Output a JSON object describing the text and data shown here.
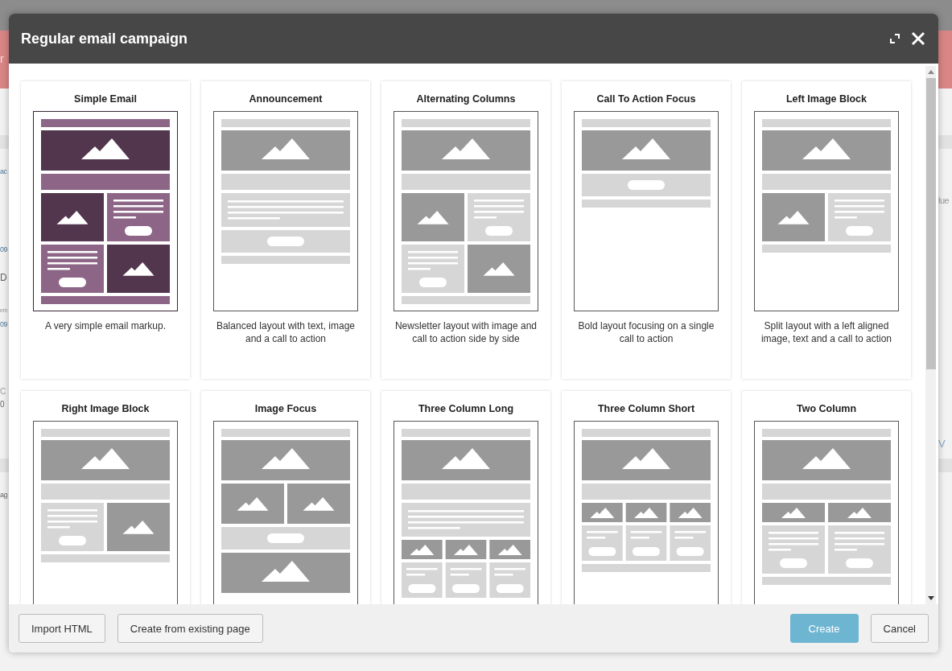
{
  "backdrop": {
    "left_texts": [
      "r",
      "ac",
      "09",
      "D",
      "em",
      "09",
      "C",
      "0",
      "ag"
    ],
    "right_texts": [
      "lue",
      "V"
    ]
  },
  "dialog": {
    "title": "Regular email campaign"
  },
  "templates": [
    {
      "title": "Simple Email",
      "description": "A very simple email markup."
    },
    {
      "title": "Announcement",
      "description": "Balanced layout with text, image and a call to action"
    },
    {
      "title": "Alternating Columns",
      "description": "Newsletter layout with image and call to action side by side"
    },
    {
      "title": "Call To Action Focus",
      "description": "Bold layout focusing on a single call to action"
    },
    {
      "title": "Left Image Block",
      "description": "Split layout with a left aligned image, text and a call to action"
    },
    {
      "title": "Right Image Block"
    },
    {
      "title": "Image Focus"
    },
    {
      "title": "Three Column Long"
    },
    {
      "title": "Three Column Short"
    },
    {
      "title": "Two Column"
    }
  ],
  "buttons": [
    {
      "label": "Import HTML",
      "kind": "secondary"
    },
    {
      "label": "Create from existing page",
      "kind": "secondary"
    },
    {
      "label": "Create",
      "kind": "primary"
    },
    {
      "label": "Cancel",
      "kind": "secondary"
    }
  ]
}
